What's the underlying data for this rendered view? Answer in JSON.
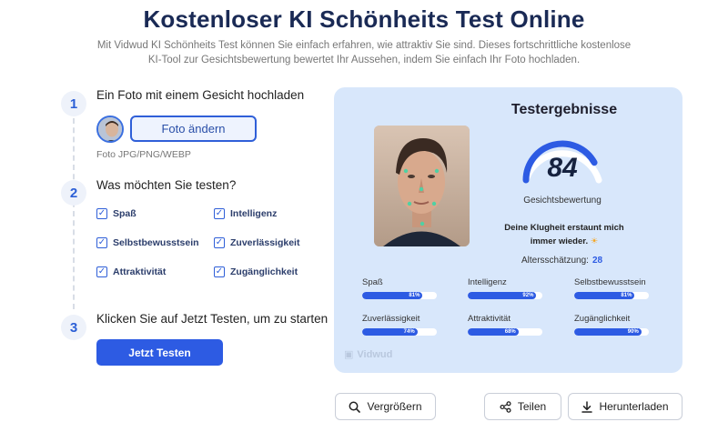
{
  "header": {
    "title": "Kostenloser KI Schönheits Test Online",
    "subtitle": "Mit Vidwud KI Schönheits Test können Sie einfach erfahren, wie attraktiv Sie sind. Dieses fortschrittliche kostenlose KI-Tool zur Gesichtsbewertung bewertet Ihr Aussehen, indem Sie einfach Ihr Foto hochladen."
  },
  "steps": [
    {
      "number": "1",
      "title": "Ein Foto mit einem Gesicht hochladen"
    },
    {
      "number": "2",
      "title": "Was möchten Sie testen?"
    },
    {
      "number": "3",
      "title": "Klicken Sie auf Jetzt Testen, um zu starten"
    }
  ],
  "upload": {
    "change_label": "Foto ändern",
    "formats": "Foto JPG/PNG/WEBP"
  },
  "options": [
    {
      "label": "Spaß",
      "checked": true
    },
    {
      "label": "Intelligenz",
      "checked": true
    },
    {
      "label": "Selbstbewusstsein",
      "checked": true
    },
    {
      "label": "Zuverlässigkeit",
      "checked": true
    },
    {
      "label": "Attraktivität",
      "checked": true
    },
    {
      "label": "Zugänglichkeit",
      "checked": true
    }
  ],
  "test_button": "Jetzt Testen",
  "results": {
    "title": "Testergebnisse",
    "score": "84",
    "score_value": 84,
    "score_label": "Gesichtsbewertung",
    "message_line1": "Deine Klugheit erstaunt mich",
    "message_line2": "immer wieder.",
    "age_label": "Altersschätzung:",
    "age_value": "28",
    "metrics": [
      {
        "label": "Spaß",
        "value": 81,
        "text": "81%"
      },
      {
        "label": "Intelligenz",
        "value": 92,
        "text": "92%"
      },
      {
        "label": "Selbstbewusstsein",
        "value": 81,
        "text": "81%"
      },
      {
        "label": "Zuverlässigkeit",
        "value": 74,
        "text": "74%"
      },
      {
        "label": "Attraktivität",
        "value": 68,
        "text": "68%"
      },
      {
        "label": "Zugänglichkeit",
        "value": 90,
        "text": "90%"
      }
    ],
    "watermark": "Vidwud"
  },
  "actions": {
    "zoom": "Vergrößern",
    "share": "Teilen",
    "download": "Herunterladen"
  },
  "colors": {
    "accent": "#2d5be3",
    "card": "#d8e7fb",
    "title": "#1a2a55"
  },
  "icons": {
    "zoom": "magnifier-icon",
    "share": "share-icon",
    "download": "download-icon",
    "checkbox": "checkmark-icon",
    "sun": "sun-emoji-icon"
  }
}
